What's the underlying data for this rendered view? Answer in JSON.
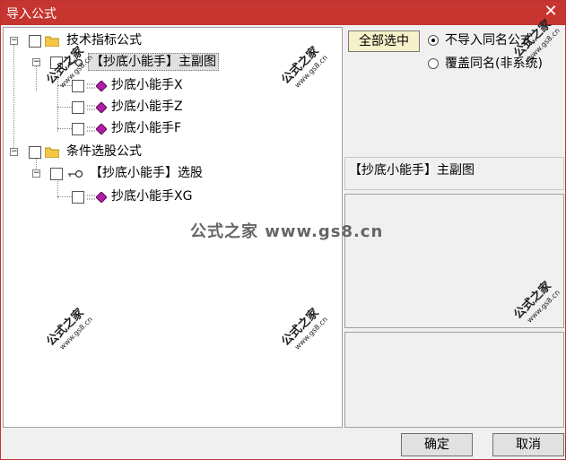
{
  "window": {
    "title": "导入公式",
    "close_glyph": "✕"
  },
  "tree": {
    "groups": [
      {
        "label": "技术指标公式",
        "subgroup": "【抄底小能手】主副图",
        "items": [
          "抄底小能手X",
          "抄底小能手Z",
          "抄底小能手F"
        ]
      },
      {
        "label": "条件选股公式",
        "subgroup": "【抄底小能手】选股",
        "items": [
          "抄底小能手XG"
        ]
      }
    ]
  },
  "right": {
    "select_all": "全部选中",
    "radio_options": [
      "不导入同名公式",
      "覆盖同名(非系统)"
    ],
    "selected_radio": 0,
    "info_text": "【抄底小能手】主副图"
  },
  "buttons": {
    "ok": "确定",
    "cancel": "取消"
  },
  "watermark": {
    "text": "公式之家",
    "url": "www.gs8.cn",
    "center": "公式之家 www.gs8.cn"
  },
  "colors": {
    "titlebar": "#c6352f",
    "select_all_bg": "#f7f1c9",
    "gem": "#b01ea8"
  }
}
